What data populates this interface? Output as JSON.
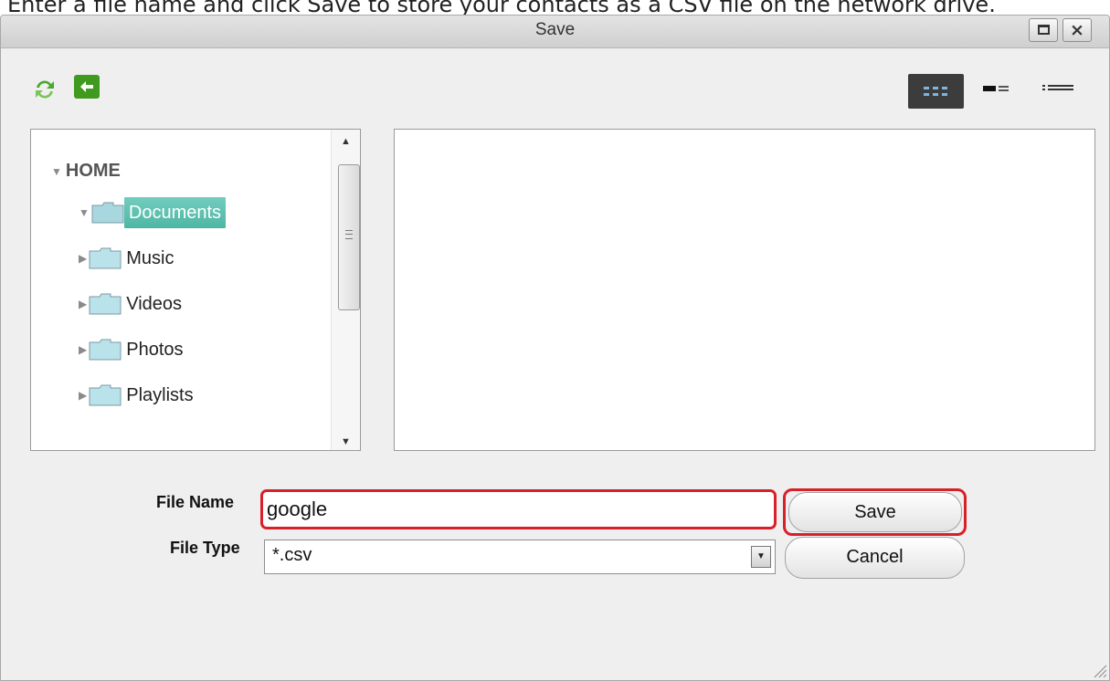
{
  "caption": "Enter a file name and click Save to store your contacts as a CSV file on the network drive.",
  "dialog": {
    "title": "Save",
    "maximize_icon": "maximize-icon",
    "close_icon": "close-icon"
  },
  "toolbar": {
    "refresh_icon": "refresh-icon",
    "back_icon": "back-arrow-icon",
    "views": [
      "grid-view-icon",
      "detail-view-icon",
      "list-view-icon"
    ],
    "active_view": "grid-view-icon"
  },
  "tree": {
    "root_label": "HOME",
    "items": [
      {
        "label": "Documents",
        "selected": true,
        "expanded": true
      },
      {
        "label": "Music",
        "selected": false,
        "expanded": false
      },
      {
        "label": "Videos",
        "selected": false,
        "expanded": false
      },
      {
        "label": "Photos",
        "selected": false,
        "expanded": false
      },
      {
        "label": "Playlists",
        "selected": false,
        "expanded": false
      }
    ]
  },
  "form": {
    "file_name_label": "File Name",
    "file_name_value": "google",
    "file_type_label": "File Type",
    "file_type_value": "*.csv",
    "save_label": "Save",
    "cancel_label": "Cancel"
  },
  "colors": {
    "highlight": "#d8202a",
    "selection": "#5fc1b1",
    "accent_green": "#3f9a1f"
  }
}
